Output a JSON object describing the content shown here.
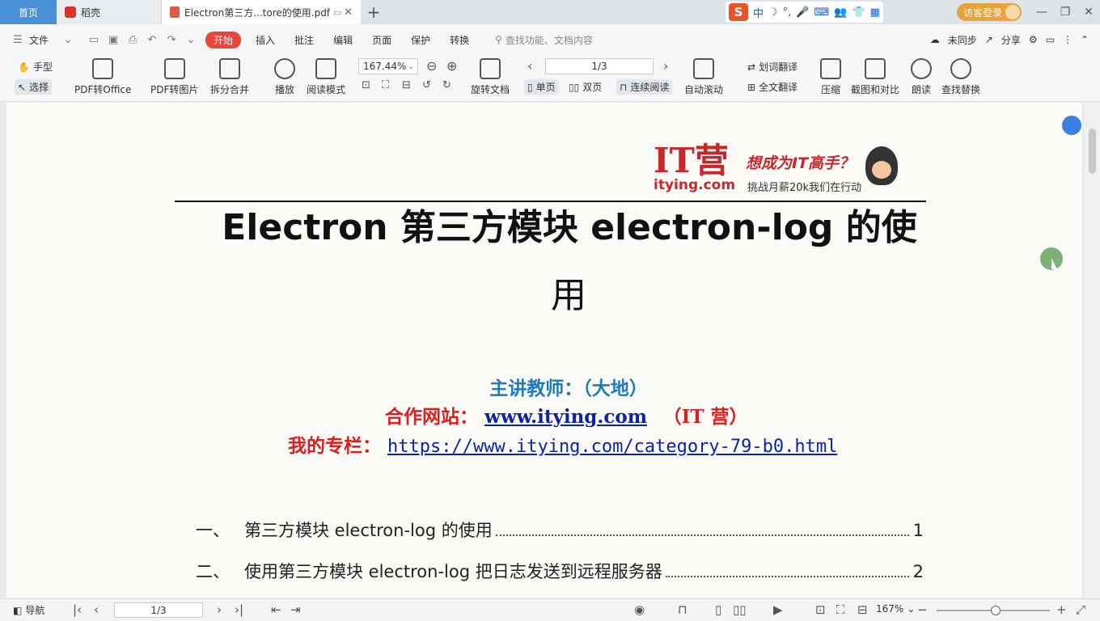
{
  "tabs": {
    "home": "首页",
    "daoke": "稻壳",
    "document": "Electron第三方...tore的使用.pdf",
    "close": "✕",
    "add": "+"
  },
  "ime": {
    "logo": "S",
    "lang": "中",
    "items": [
      "☽",
      "°,",
      "🎤",
      "⌨",
      "👥",
      "👕",
      "▦"
    ]
  },
  "login": "访客登录",
  "window": {
    "minimize": "—",
    "restore": "❐",
    "close": "✕"
  },
  "menu": {
    "file": "文件",
    "items": [
      "开始",
      "插入",
      "批注",
      "编辑",
      "页面",
      "保护",
      "转换"
    ],
    "search": "查找功能、文档内容",
    "sync": "未同步",
    "share": "分享"
  },
  "toolbar": {
    "hand": "手型",
    "select": "选择",
    "pdf_office": "PDF转Office",
    "pdf_image": "PDF转图片",
    "split_merge": "拆分合并",
    "play": "播放",
    "read_mode": "阅读模式",
    "zoom": "167.44%",
    "rotate_doc": "旋转文档",
    "page_indicator": "1/3",
    "single": "单页",
    "double": "双页",
    "continuous": "连续阅读",
    "auto_scroll": "自动滚动",
    "word_translate": "划词翻译",
    "full_translate": "全文翻译",
    "compress": "压缩",
    "capture_compare": "截图和对比",
    "read_aloud": "朗读",
    "find_replace": "查找替换"
  },
  "document": {
    "logo": {
      "brand": "IT营",
      "site": "itying.com",
      "slogan": "想成为IT高手？",
      "tagline": "挑战月薪20k我们在行动"
    },
    "title_line1": "Electron 第三方模块 electron-log 的使",
    "title_line2": "用",
    "teacher": "主讲教师：（大地）",
    "coop_label": "合作网站：",
    "coop_link": "www.itying.com",
    "coop_suffix": "　（IT 营）",
    "column_label": "我的专栏：",
    "column_link": "https://www.itying.com/category-79-b0.html",
    "toc": [
      {
        "num": "一、",
        "text": "第三方模块 electron-log 的使用",
        "page": "1"
      },
      {
        "num": "二、",
        "text": "使用第三方模块 electron-log 把日志发送到远程服务器",
        "page": "2"
      }
    ]
  },
  "status": {
    "nav": "导航",
    "page": "1/3",
    "zoom": "167%"
  },
  "colors": {
    "accent": "#e8463b",
    "teacher": "#1d7bb8",
    "red_text": "#d92020",
    "link": "#0a24a6",
    "login": "#e8a33c"
  }
}
